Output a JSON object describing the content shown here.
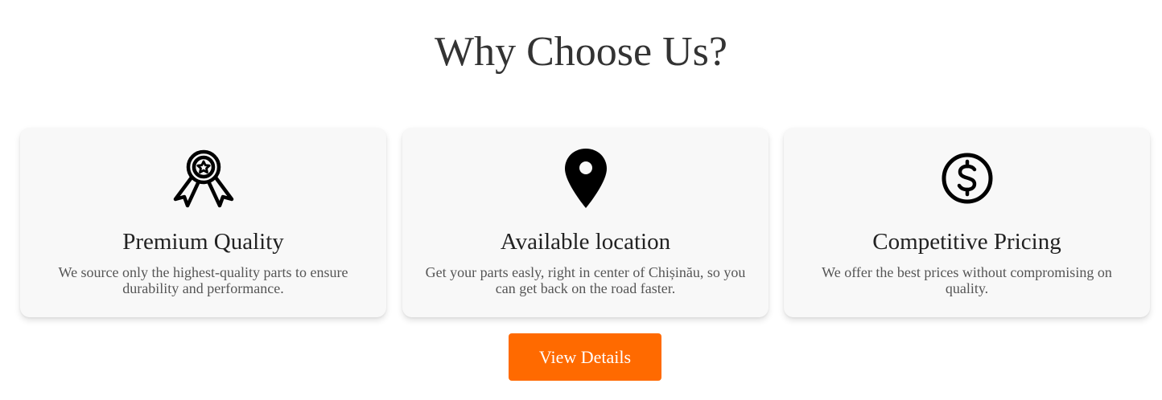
{
  "section": {
    "title": "Why Choose Us?"
  },
  "features": [
    {
      "icon": "award-ribbon-icon",
      "title": "Premium Quality",
      "description": "We source only the highest-quality parts to ensure durability and performance."
    },
    {
      "icon": "location-pin-icon",
      "title": "Available location",
      "description": "Get your parts easly, right in center of Chișinău, so you can get back on the road faster."
    },
    {
      "icon": "dollar-circle-icon",
      "title": "Competitive Pricing",
      "description": "We offer the best prices without compromising on quality."
    }
  ],
  "cta": {
    "label": "View Details",
    "color": "#ff6a00"
  },
  "colors": {
    "card_background": "#f8f8f8",
    "heading": "#333333",
    "body_text": "#555555"
  }
}
